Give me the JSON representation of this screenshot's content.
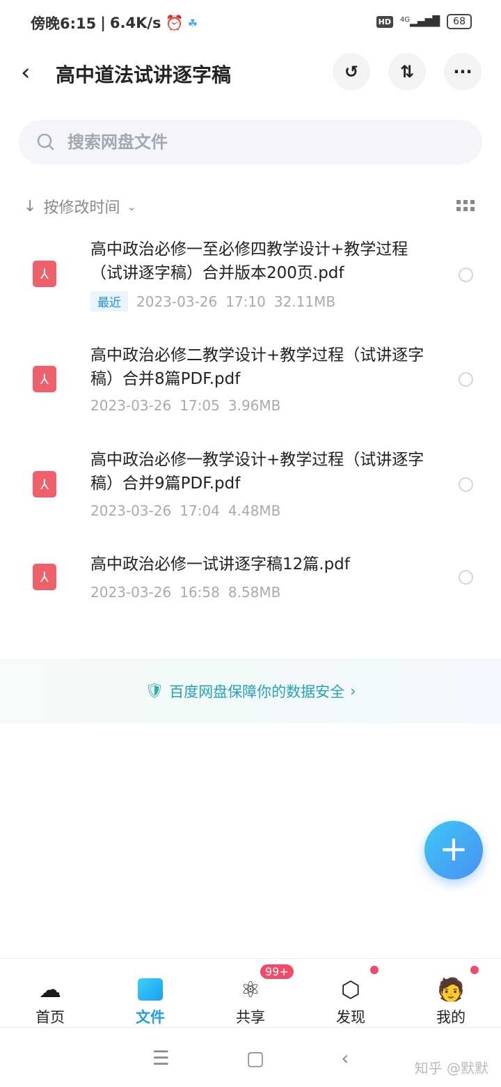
{
  "status": {
    "time": "傍晚6:15",
    "speed": "6.4K/s",
    "network": "4G",
    "hd": "HD",
    "battery": "68"
  },
  "header": {
    "title": "高中道法试讲逐字稿"
  },
  "search": {
    "placeholder": "搜索网盘文件"
  },
  "sort": {
    "label": "按修改时间"
  },
  "files": [
    {
      "title": "高中政治必修一至必修四教学设计+教学过程（试讲逐字稿）合并版本200页.pdf",
      "tag": "最近",
      "date": "2023-03-26",
      "time": "17:10",
      "size": "32.11MB"
    },
    {
      "title": "高中政治必修二教学设计+教学过程（试讲逐字稿）合并8篇PDF.pdf",
      "date": "2023-03-26",
      "time": "17:05",
      "size": "3.96MB"
    },
    {
      "title": "高中政治必修一教学设计+教学过程（试讲逐字稿）合并9篇PDF.pdf",
      "date": "2023-03-26",
      "time": "17:04",
      "size": "4.48MB"
    },
    {
      "title": "高中政治必修一试讲逐字稿12篇.pdf",
      "date": "2023-03-26",
      "time": "16:58",
      "size": "8.58MB"
    }
  ],
  "banner": {
    "text": "百度网盘保障你的数据安全"
  },
  "tabs": [
    {
      "label": "首页"
    },
    {
      "label": "文件"
    },
    {
      "label": "共享",
      "badge": "99+"
    },
    {
      "label": "发现"
    },
    {
      "label": "我的"
    }
  ],
  "watermark": "知乎 @默默",
  "colors": {
    "accent": "#1aa0e8",
    "pdf": "#f0606a",
    "badge": "#f04b6a"
  }
}
